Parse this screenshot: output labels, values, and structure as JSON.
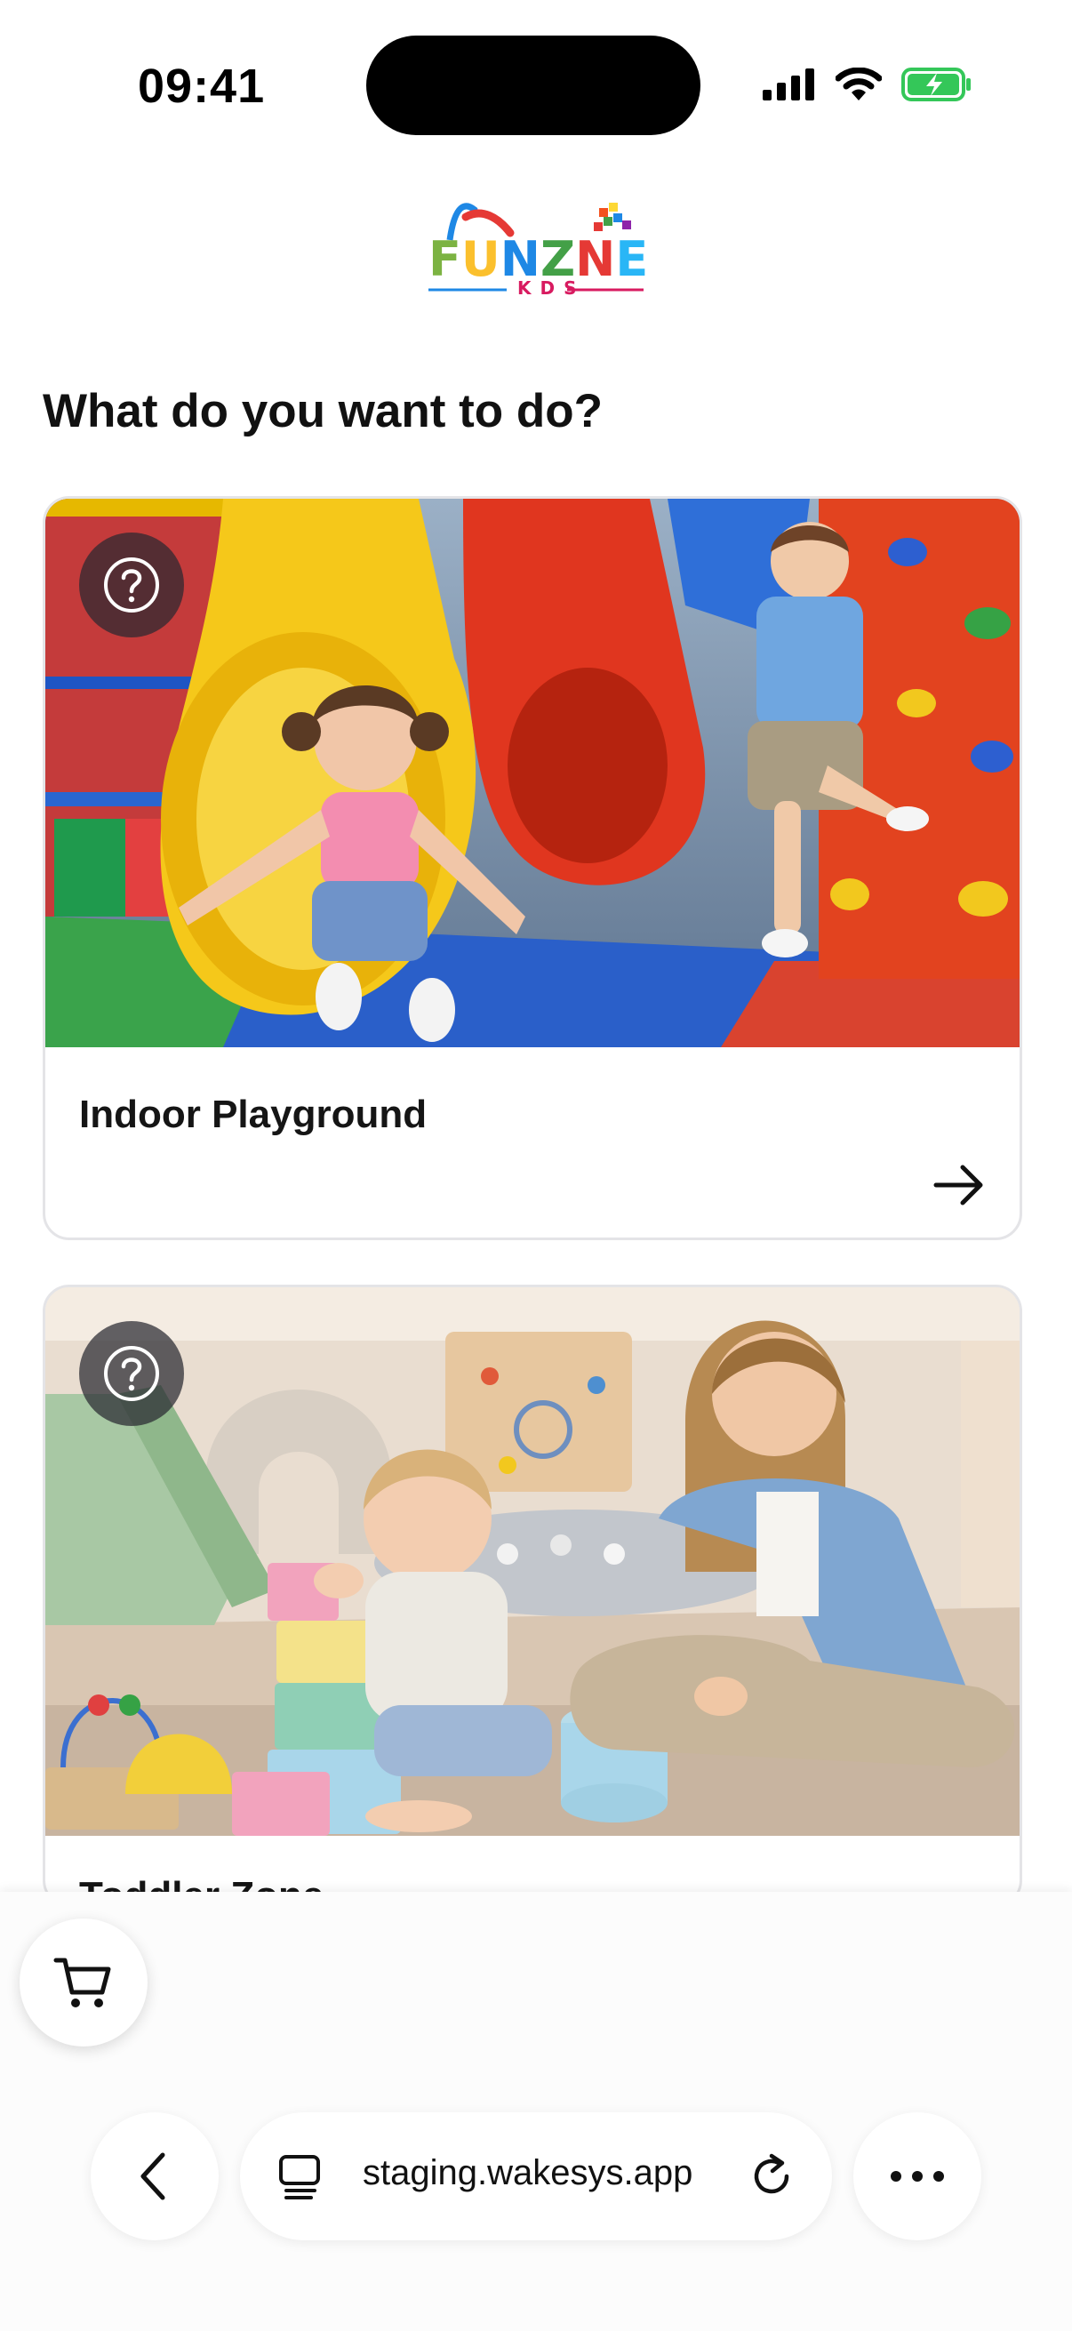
{
  "status": {
    "time": "09:41"
  },
  "logo": {
    "text": "FUNZNE",
    "subtext": "KDS"
  },
  "page": {
    "heading": "What do you want to do?"
  },
  "cards": [
    {
      "title": "Indoor Playground",
      "image": "indoor-playground-photo"
    },
    {
      "title": "Toddler Zone",
      "image": "toddler-zone-photo"
    }
  ],
  "browser": {
    "url": "staging.wakesys.app"
  },
  "icons": {
    "help": "question-circle-icon",
    "arrow": "arrow-right-icon",
    "cart": "cart-icon",
    "back": "chevron-left-icon",
    "tabs": "tab-icon",
    "reload": "reload-icon",
    "more": "more-icon"
  },
  "colors": {
    "accent": "#111111",
    "card_border": "#e4e4e7",
    "battery": "#34c759"
  }
}
